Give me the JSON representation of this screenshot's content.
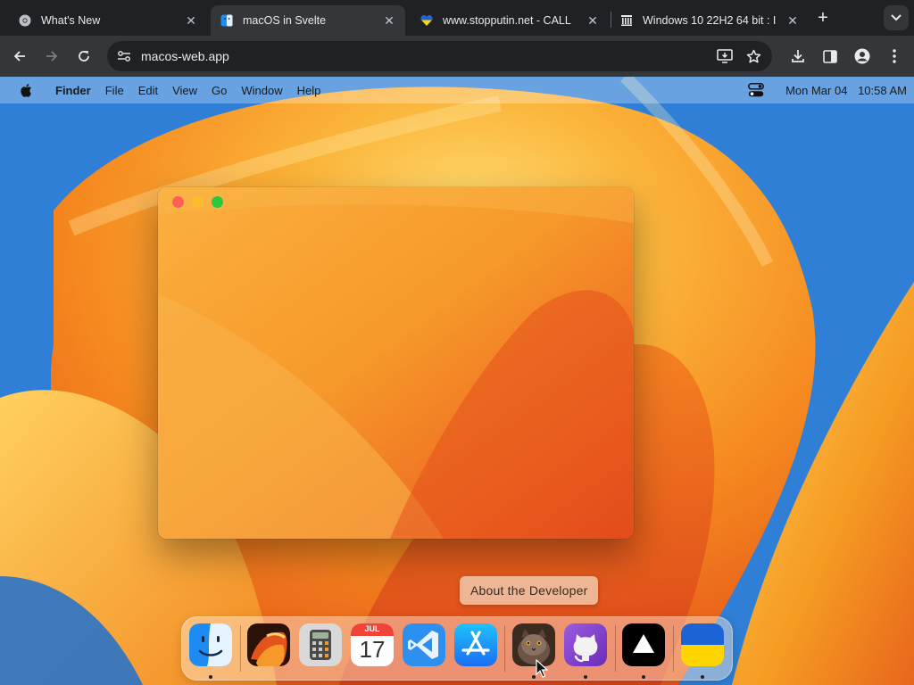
{
  "browser": {
    "tabs": [
      {
        "title": "What's New",
        "favicon": "chrome-icon",
        "active": false
      },
      {
        "title": "macOS in Svelte",
        "favicon": "finder-icon",
        "active": true
      },
      {
        "title": "www.stopputin.net - CALL",
        "favicon": "ukraine-heart-icon",
        "active": false
      },
      {
        "title": "Windows 10 22H2 64 bit : I",
        "favicon": "archive-icon",
        "active": false
      }
    ],
    "close_glyph": "✕",
    "new_tab_glyph": "+",
    "url": "macos-web.app"
  },
  "menubar": {
    "app_name": "Finder",
    "items": [
      "File",
      "Edit",
      "View",
      "Go",
      "Window",
      "Help"
    ],
    "date": "Mon Mar 04",
    "time": "10:58 AM"
  },
  "window": {
    "traffic_colors": {
      "close": "#ff5f57",
      "minimize": "#febc2e",
      "zoom": "#28c840"
    }
  },
  "dock": {
    "tooltip": "About the Developer",
    "apps": [
      {
        "name": "Finder",
        "icon": "finder-icon",
        "running": true
      },
      {
        "name": "Wallpapers",
        "icon": "wallpaper-icon",
        "running": false
      },
      {
        "name": "Calculator",
        "icon": "calculator-icon",
        "running": false
      },
      {
        "name": "Calendar",
        "icon": "calendar-icon",
        "running": false,
        "month": "JUL",
        "day": "17"
      },
      {
        "name": "VS Code",
        "icon": "vscode-icon",
        "running": false
      },
      {
        "name": "App Store",
        "icon": "appstore-icon",
        "running": false
      },
      {
        "name": "About the Developer",
        "icon": "developer-avatar-icon",
        "running": true
      },
      {
        "name": "GitHub",
        "icon": "github-icon",
        "running": true
      },
      {
        "name": "Vercel",
        "icon": "vercel-icon",
        "running": true
      },
      {
        "name": "Ukraine",
        "icon": "ukraine-flag-icon",
        "running": true
      }
    ]
  },
  "colors": {
    "accent_orange": "#f5a623",
    "sky_blue": "#2f7fd6"
  }
}
